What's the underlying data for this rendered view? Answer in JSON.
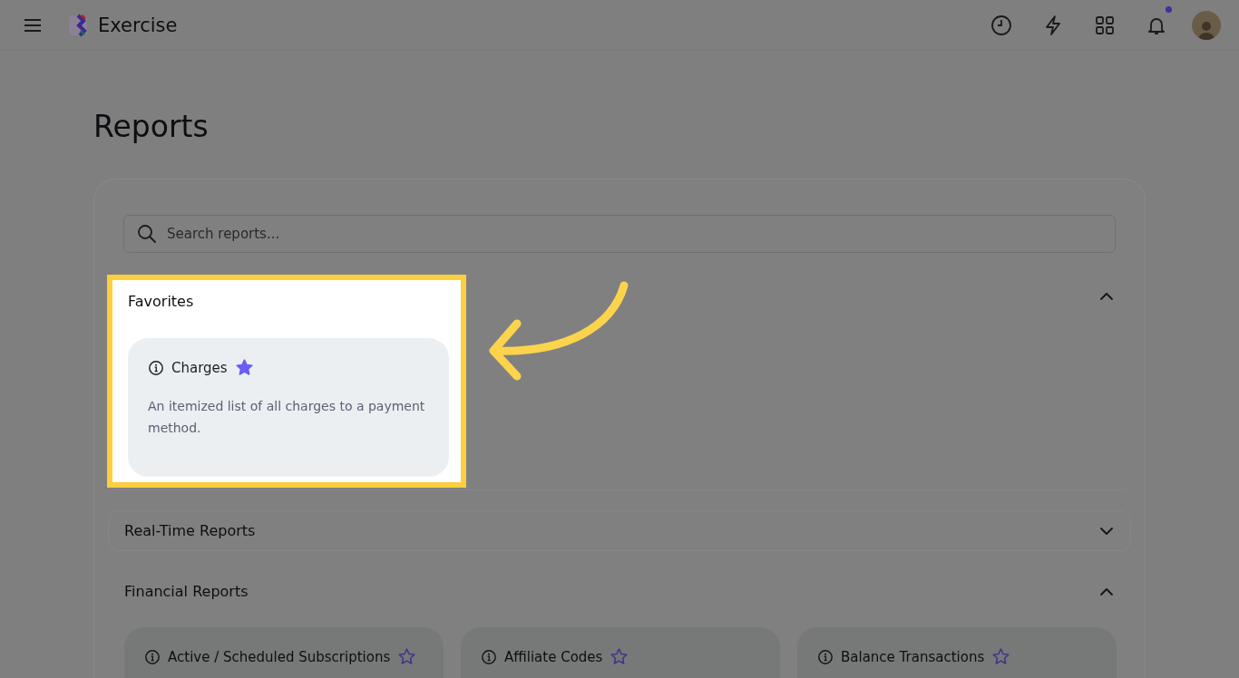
{
  "app": {
    "name": "Exercise"
  },
  "header": {
    "notifications_unread": true
  },
  "page": {
    "title": "Reports"
  },
  "search": {
    "placeholder": "Search reports..."
  },
  "sections": [
    {
      "title": "Favorites",
      "expanded": true,
      "highlighted": true,
      "reports": [
        {
          "name": "Charges",
          "description": "An itemized list of all charges to a payment method.",
          "favorite": true
        }
      ]
    },
    {
      "title": "Real-Time Reports",
      "expanded": false
    },
    {
      "title": "Financial Reports",
      "expanded": true,
      "reports": [
        {
          "name": "Active / Scheduled Subscriptions",
          "favorite": false
        },
        {
          "name": "Affiliate Codes",
          "favorite": false
        },
        {
          "name": "Balance Transactions",
          "favorite": false
        }
      ]
    }
  ]
}
